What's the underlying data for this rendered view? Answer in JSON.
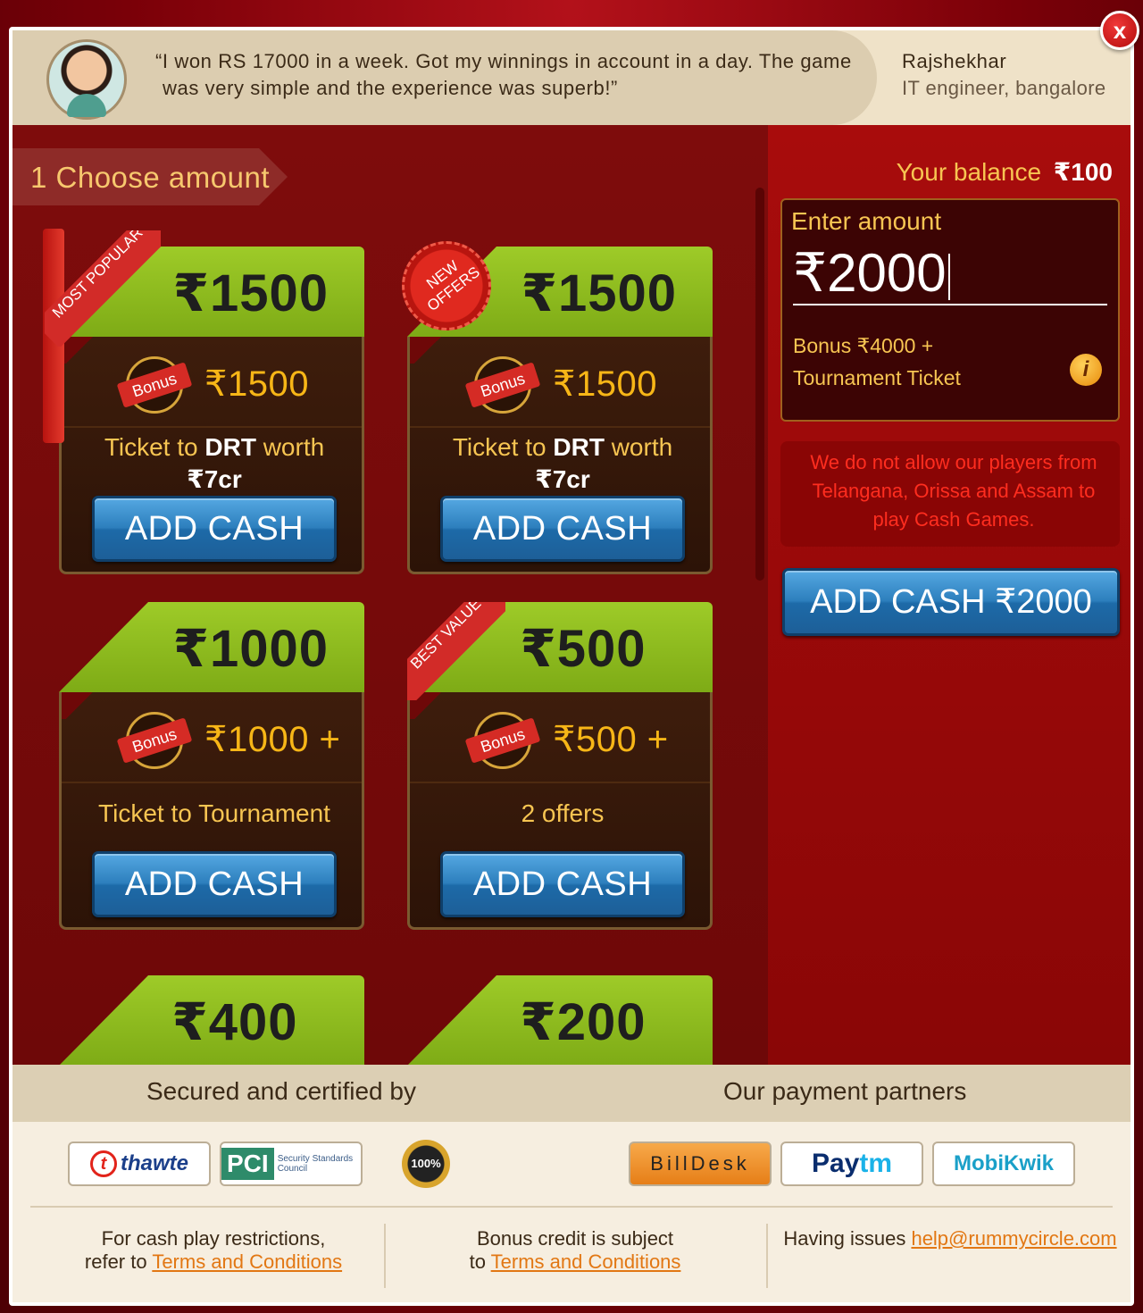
{
  "close_label": "x",
  "testimonial": {
    "quote_line1": "“I won RS 17000 in a week. Got my winnings in account in a day. The game",
    "quote_line2": "was very simple and the experience was superb!”",
    "author_name": "Rajshekhar",
    "author_role": "IT engineer, bangalore"
  },
  "step": {
    "label": "1 Choose amount"
  },
  "cards": [
    {
      "price": "₹1500",
      "badge": "MOST POPULAR",
      "bonus_label": "Bonus",
      "bonus": "₹1500",
      "line1_pre": "Ticket to ",
      "line1_bold": "DRT",
      "line1_post": " worth",
      "line2": "₹7cr",
      "button": "ADD CASH"
    },
    {
      "price": "₹1500",
      "badge": "NEW OFFERS",
      "bonus_label": "Bonus",
      "bonus": "₹1500",
      "line1_pre": "Ticket to ",
      "line1_bold": "DRT",
      "line1_post": " worth",
      "line2": "₹7cr",
      "button": "ADD CASH"
    },
    {
      "price": "₹1000",
      "badge": "",
      "bonus_label": "Bonus",
      "bonus": "₹1000 +",
      "line1": "Ticket to Tournament",
      "button": "ADD CASH"
    },
    {
      "price": "₹500",
      "badge": "BEST VALUE",
      "bonus_label": "Bonus",
      "bonus": "₹500 +",
      "line1": "2 offers",
      "button": "ADD CASH"
    },
    {
      "price": "₹400"
    },
    {
      "price": "₹200"
    }
  ],
  "right": {
    "balance_label": "Your balance",
    "balance_value": "₹100",
    "enter_label": "Enter amount",
    "amount_value": "₹2000",
    "bonus_line1": "Bonus ₹4000 +",
    "bonus_line2": "Tournament Ticket",
    "info_icon": "i",
    "restriction": "We do not allow our players from Telangana, Orissa and Assam to play Cash Games.",
    "add_cash_label": "ADD CASH ₹2000"
  },
  "footer": {
    "secured_title": "Secured and certified by",
    "partners_title": "Our payment partners",
    "thawte": "thawte",
    "thawte_tag": "t",
    "pci": "PCI",
    "pci_sub": "Security Standards Council",
    "guarantee": "100%",
    "billdesk": "BillDesk",
    "paytm_a": "Pay",
    "paytm_b": "tm",
    "mobikwik": "MobiKwik",
    "col1_line1": "For cash play restrictions,",
    "col1_line2": "refer to ",
    "col1_link": "Terms and Conditions",
    "col2_line1": "Bonus  credit is subject",
    "col2_line2": "to ",
    "col2_link": "Terms and Conditions",
    "col3_text": "Having issues ",
    "col3_link": "help@rummycircle.com"
  },
  "colors": {
    "accent_gold": "#f7c552",
    "card_green": "#8fbf1e",
    "button_blue": "#2d7fbd",
    "warning_red": "#ff2d1f"
  }
}
